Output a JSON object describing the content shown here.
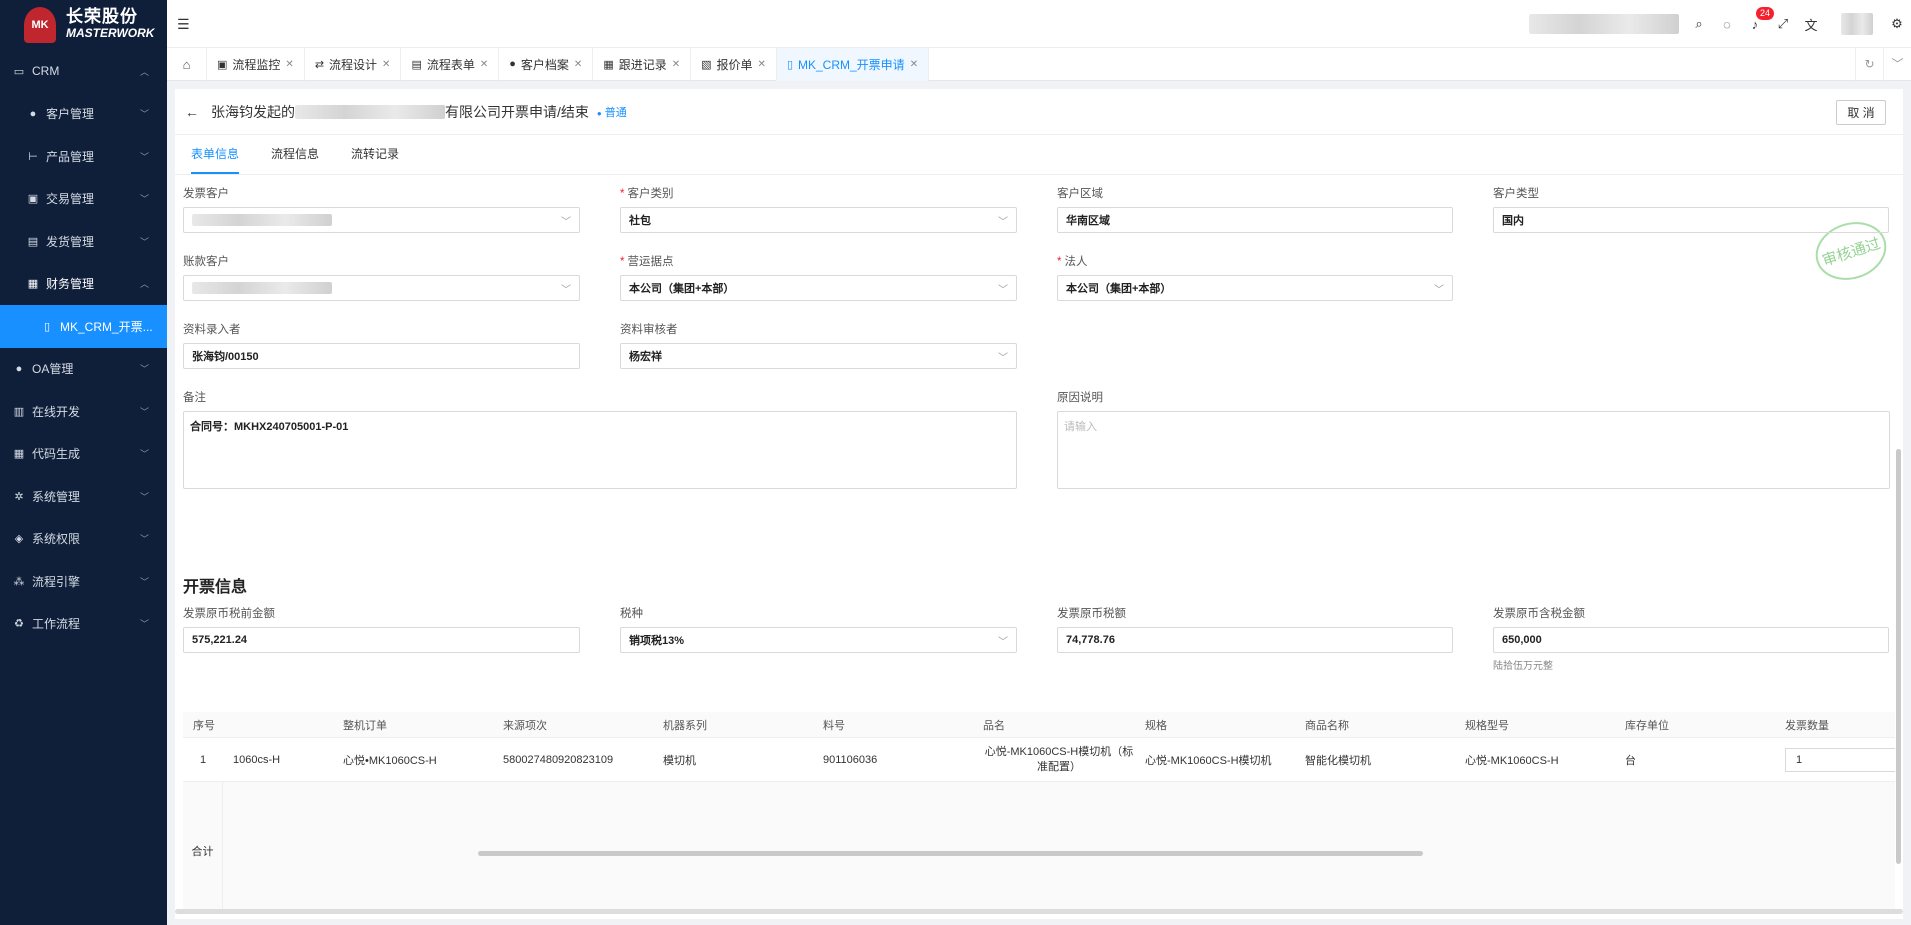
{
  "brand": {
    "name_cn": "长荣股份",
    "name_en": "MASTERWORK",
    "mark": "MK"
  },
  "sidebar": {
    "items": [
      {
        "label": "CRM",
        "icon": "laptop-icon"
      },
      {
        "label": "客户管理",
        "icon": "user-icon"
      },
      {
        "label": "产品管理",
        "icon": "product-icon"
      },
      {
        "label": "交易管理",
        "icon": "bag-icon"
      },
      {
        "label": "发货管理",
        "icon": "box-icon"
      },
      {
        "label": "财务管理",
        "icon": "finance-icon"
      },
      {
        "label": "MK_CRM_开票...",
        "icon": "doc-icon"
      },
      {
        "label": "OA管理",
        "icon": "user-icon"
      },
      {
        "label": "在线开发",
        "icon": "dev-icon"
      },
      {
        "label": "代码生成",
        "icon": "code-icon"
      },
      {
        "label": "系统管理",
        "icon": "gear-icon"
      },
      {
        "label": "系统权限",
        "icon": "shield-icon"
      },
      {
        "label": "流程引擎",
        "icon": "flow-icon"
      },
      {
        "label": "工作流程",
        "icon": "workflow-icon"
      }
    ]
  },
  "topbar": {
    "notifications": "24"
  },
  "tabs": [
    {
      "label": "流程监控"
    },
    {
      "label": "流程设计"
    },
    {
      "label": "流程表单"
    },
    {
      "label": "客户档案"
    },
    {
      "label": "跟进记录"
    },
    {
      "label": "报价单"
    },
    {
      "label": "MK_CRM_开票申请"
    }
  ],
  "header": {
    "title_prefix": "张海钧发起的",
    "title_suffix": "有限公司开票申请/结束",
    "tag": "普通",
    "cancel": "取 消"
  },
  "subtabs": [
    "表单信息",
    "流程信息",
    "流转记录"
  ],
  "stamp": "审核通过",
  "form": {
    "invoice_customer": {
      "label": "发票客户"
    },
    "customer_category": {
      "label": "客户类别",
      "value": "社包"
    },
    "customer_region": {
      "label": "客户区域",
      "value": "华南区域"
    },
    "customer_type": {
      "label": "客户类型",
      "value": "国内"
    },
    "account_customer": {
      "label": "账款客户"
    },
    "business_point": {
      "label": "营运据点",
      "value": "本公司（集团+本部）"
    },
    "legal_person": {
      "label": "法人",
      "value": "本公司（集团+本部）"
    },
    "data_entry": {
      "label": "资料录入者",
      "value": "张海钧/00150"
    },
    "data_reviewer": {
      "label": "资料审核者",
      "value": "杨宏祥"
    },
    "remark": {
      "label": "备注",
      "value": "合同号：MKHX240705001-P-01"
    },
    "reason": {
      "label": "原因说明",
      "placeholder": "请输入"
    }
  },
  "invoice": {
    "section_title": "开票信息",
    "pre_tax": {
      "label": "发票原币税前金额",
      "value": "575,221.24"
    },
    "tax_type": {
      "label": "税种",
      "value": "销项税13%"
    },
    "tax_amount": {
      "label": "发票原币税额",
      "value": "74,778.76"
    },
    "total": {
      "label": "发票原币含税金额",
      "value": "650,000",
      "note": "陆拾伍万元整"
    }
  },
  "table": {
    "headers": [
      "序号",
      "",
      "整机订单",
      "来源项次",
      "机器系列",
      "料号",
      "品名",
      "规格",
      "商品名称",
      "规格型号",
      "库存单位",
      "发票数量"
    ],
    "rows": [
      [
        "1",
        "1060cs-H",
        "心悦•MK1060CS-H",
        "580027480920823109",
        "模切机",
        "901106036",
        "心悦-MK1060CS-H模切机（标准配置）",
        "心悦-MK1060CS-H模切机",
        "智能化模切机",
        "心悦-MK1060CS-H",
        "台",
        "1"
      ]
    ],
    "total_label": "合计"
  }
}
